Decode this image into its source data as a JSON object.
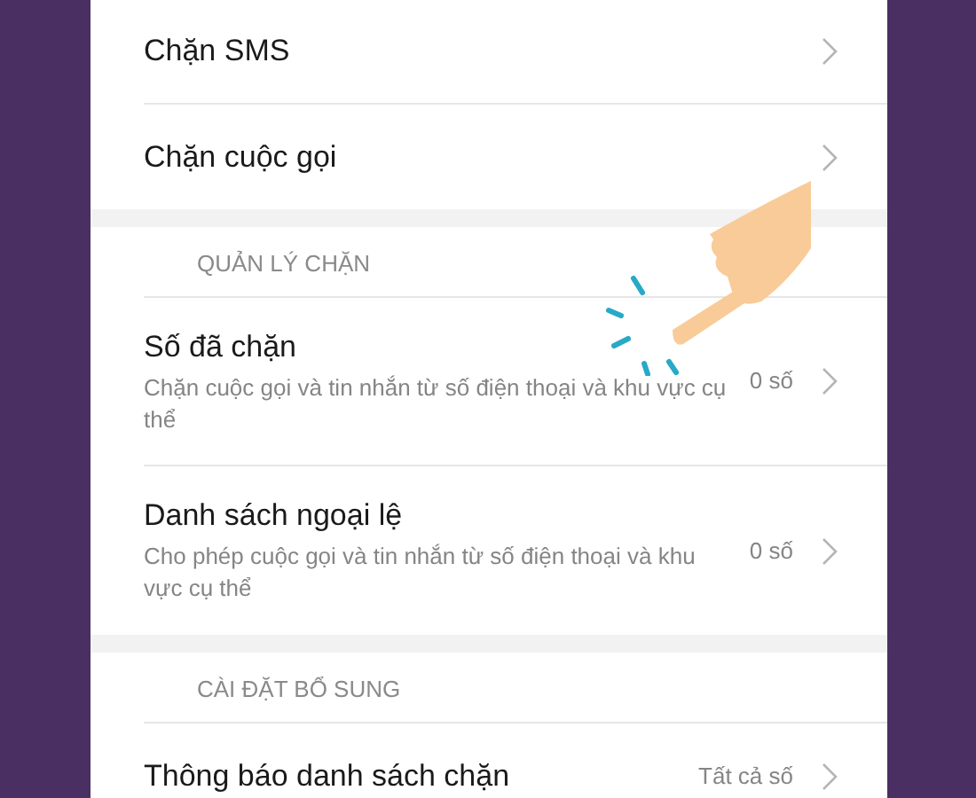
{
  "sections": [
    {
      "items": [
        {
          "title": "Chặn SMS"
        },
        {
          "title": "Chặn cuộc gọi"
        }
      ]
    },
    {
      "header": "QUẢN LÝ CHẶN",
      "items": [
        {
          "title": "Số đã chặn",
          "subtitle": "Chặn cuộc gọi và tin nhắn từ số điện thoại và khu vực cụ thể",
          "value": "0 số"
        },
        {
          "title": "Danh sách ngoại lệ",
          "subtitle": "Cho phép cuộc gọi và tin nhắn từ số điện thoại và khu vực cụ thể",
          "value": "0 số"
        }
      ]
    },
    {
      "header": "CÀI ĐẶT BỔ SUNG",
      "items": [
        {
          "title": "Thông báo danh sách chặn",
          "value": "Tất cả số"
        }
      ]
    }
  ]
}
